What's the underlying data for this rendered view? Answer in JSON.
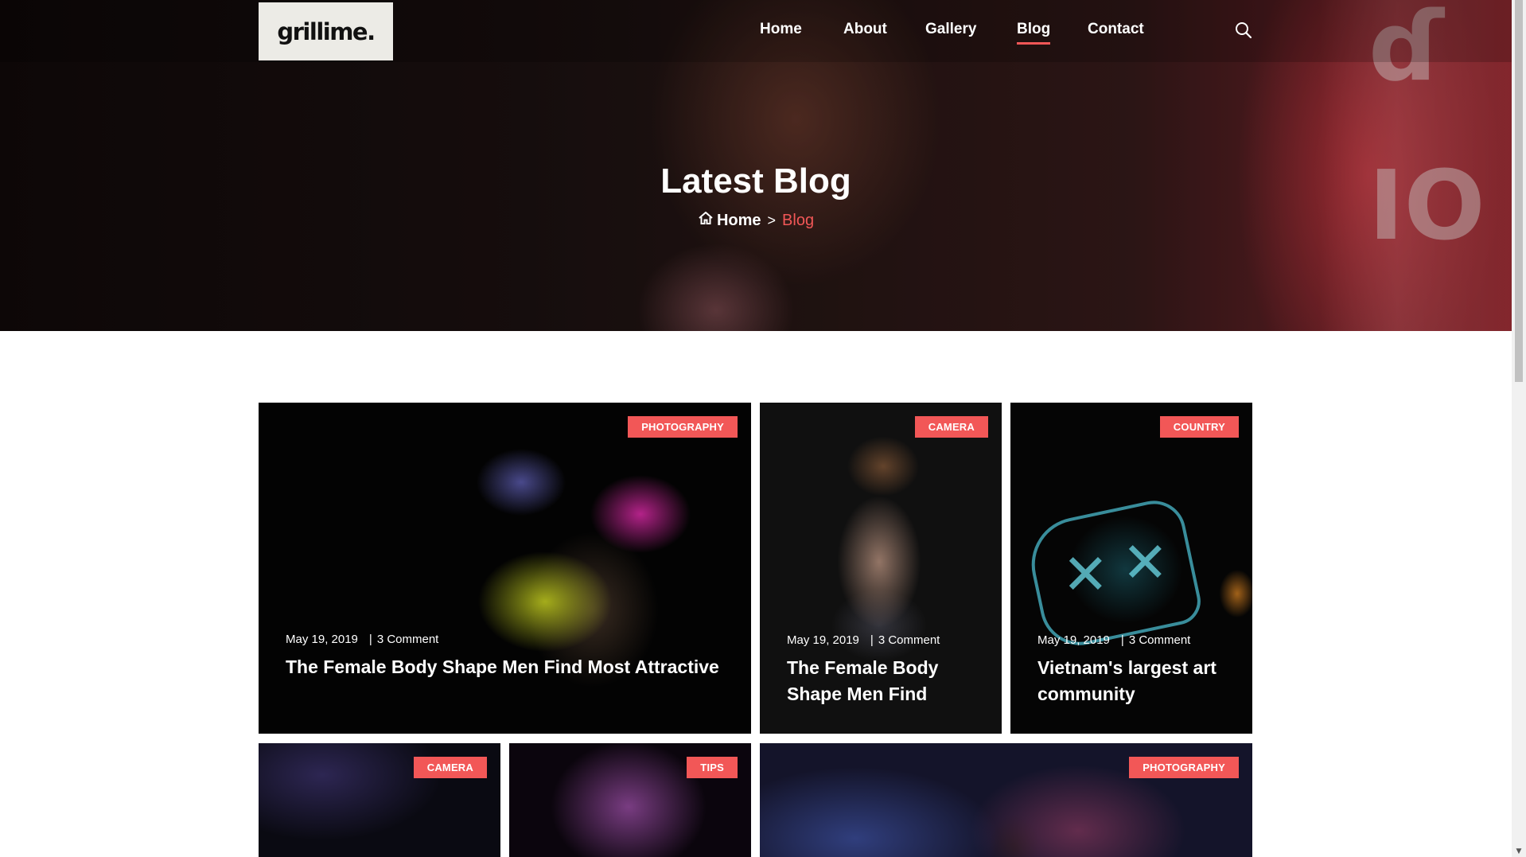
{
  "brand": {
    "logo_text": "grillime."
  },
  "nav": {
    "items": [
      {
        "label": "Home",
        "active": false
      },
      {
        "label": "About",
        "active": false
      },
      {
        "label": "Gallery",
        "active": false
      },
      {
        "label": "Blog",
        "active": true
      },
      {
        "label": "Contact",
        "active": false
      }
    ],
    "search_icon": "search-icon"
  },
  "hero": {
    "title": "Latest Blog",
    "breadcrumb": {
      "home": "Home",
      "separator": ">",
      "current": "Blog"
    }
  },
  "posts": [
    {
      "tag": "PHOTOGRAPHY",
      "date": "May 19, 2019",
      "comments": "3 Comment",
      "title": "The Female Body Shape Men Find Most Attractive"
    },
    {
      "tag": "CAMERA",
      "date": "May 19, 2019",
      "comments": "3 Comment",
      "title": "The Female Body Shape Men Find"
    },
    {
      "tag": "COUNTRY",
      "date": "May 19, 2019",
      "comments": "3 Comment",
      "title": "Vietnam's largest art community"
    },
    {
      "tag": "CAMERA"
    },
    {
      "tag": "TIPS"
    },
    {
      "tag": "PHOTOGRAPHY"
    }
  ],
  "colors": {
    "accent": "#f25757",
    "logo_bg": "#ecebe6"
  }
}
